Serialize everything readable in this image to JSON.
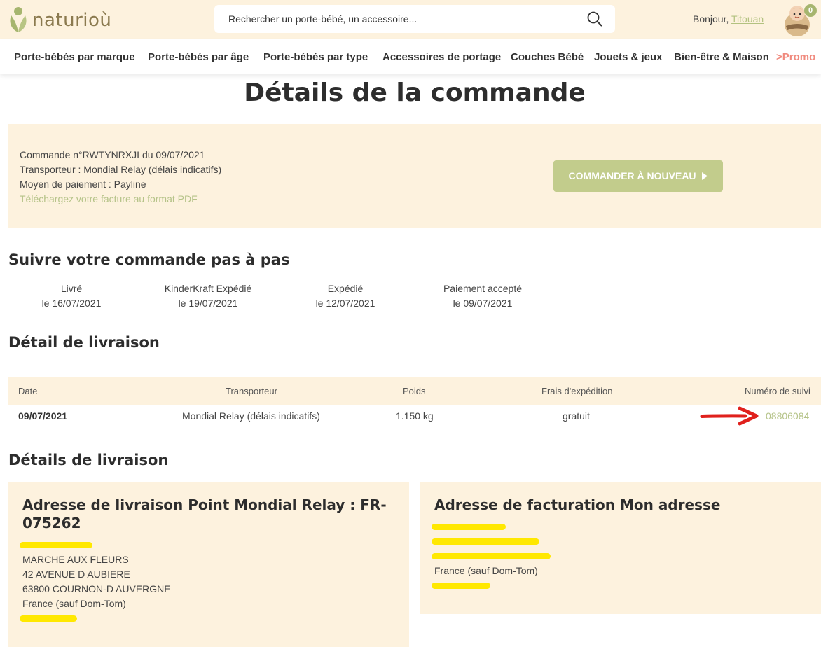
{
  "header": {
    "logo_text": "naturioù",
    "search_placeholder": "Rechercher un porte-bébé, un accessoire...",
    "greeting_prefix": "Bonjour,",
    "user_name": "Titouan",
    "cart_count": "0"
  },
  "nav": {
    "items": [
      "Porte-bébés par marque",
      "Porte-bébés par âge",
      "Porte-bébés par type",
      "Accessoires de portage",
      "Couches Bébé",
      "Jouets & jeux",
      "Bien-être & Maison",
      "Promo"
    ]
  },
  "page": {
    "title": "Détails de la commande"
  },
  "order": {
    "line1": "Commande n°RWTYNRXJI du 09/07/2021",
    "line2": "Transporteur : Mondial Relay (délais indicatifs)",
    "line3": "Moyen de paiement : Payline",
    "invoice_link": "Téléchargez votre facture au format PDF",
    "reorder_button": "COMMANDER À NOUVEAU"
  },
  "tracking_section": {
    "title": "Suivre votre commande pas à pas",
    "steps": [
      {
        "status": "Livré",
        "date": "le 16/07/2021"
      },
      {
        "status": "KinderKraft Expédié",
        "date": "le 19/07/2021"
      },
      {
        "status": "Expédié",
        "date": "le 12/07/2021"
      },
      {
        "status": "Paiement accepté",
        "date": "le 09/07/2021"
      }
    ]
  },
  "shipping_detail": {
    "title": "Détail de livraison",
    "headers": {
      "date": "Date",
      "carrier": "Transporteur",
      "weight": "Poids",
      "fees": "Frais d'expédition",
      "tracking": "Numéro de suivi"
    },
    "row": {
      "date": "09/07/2021",
      "carrier": "Mondial Relay (délais indicatifs)",
      "weight": "1.150 kg",
      "fees": "gratuit",
      "tracking": "08806084"
    }
  },
  "delivery_details": {
    "title": "Détails de livraison",
    "shipping_address": {
      "title": "Adresse de livraison Point Mondial Relay : FR-075262",
      "lines": [
        "MARCHE AUX FLEURS",
        "42 AVENUE D AUBIERE",
        "63800 COURNON-D AUVERGNE",
        "France (sauf Dom-Tom)"
      ]
    },
    "billing_address": {
      "title": "Adresse de facturation Mon adresse",
      "lines": [
        "France (sauf Dom-Tom)"
      ]
    }
  },
  "colors": {
    "beige": "#fdf2de",
    "accent_green": "#c2cc8c",
    "link_green": "#b5c388",
    "promo": "#f08a7e",
    "highlighter": "#ffe800",
    "arrow_red": "#e0201c"
  }
}
